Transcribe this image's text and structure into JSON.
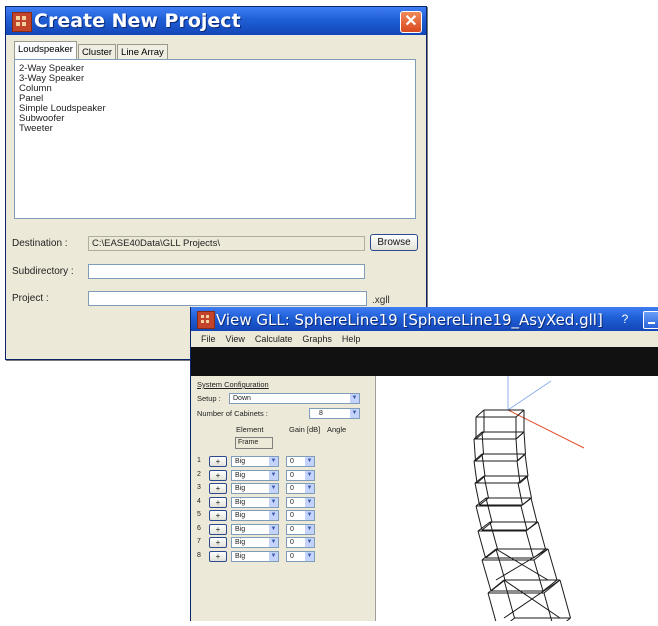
{
  "create_project": {
    "title": "Create New Project",
    "close_glyph": "✕",
    "tabs": [
      "Loudspeaker",
      "Cluster",
      "Line Array"
    ],
    "list_items": [
      "2-Way Speaker",
      "3-Way Speaker",
      "Column",
      "Panel",
      "Simple Loudspeaker",
      "Subwoofer",
      "Tweeter"
    ],
    "destination_label": "Destination :",
    "destination_value": "C:\\EASE40Data\\GLL Projects\\",
    "browse_label": "Browse",
    "subdirectory_label": "Subdirectory :",
    "subdirectory_value": "",
    "project_label": "Project :",
    "project_value": "",
    "project_suffix": ".xgll"
  },
  "view_gll": {
    "title": "View GLL: SphereLine19 [SphereLine19_AsyXed.gll]",
    "help_glyph": "?",
    "menu": [
      "File",
      "View",
      "Calculate",
      "Graphs",
      "Help"
    ],
    "config": {
      "section_title": "System Configuration",
      "setup_label": "Setup :",
      "setup_value": "Down",
      "cabinets_label": "Number of Cabinets :",
      "cabinets_value": "8",
      "col_element": "Element",
      "col_gain": "Gain [dB]",
      "col_angle": "Angle",
      "frame_label": "Frame",
      "plus_glyph": "+",
      "rows": [
        {
          "num": "1",
          "element": "Big",
          "gain": "0"
        },
        {
          "num": "2",
          "element": "Big",
          "gain": "0"
        },
        {
          "num": "3",
          "element": "Big",
          "gain": "0"
        },
        {
          "num": "4",
          "element": "Big",
          "gain": "0"
        },
        {
          "num": "5",
          "element": "Big",
          "gain": "0"
        },
        {
          "num": "6",
          "element": "Big",
          "gain": "0"
        },
        {
          "num": "7",
          "element": "Big",
          "gain": "0"
        },
        {
          "num": "8",
          "element": "Big",
          "gain": "0"
        }
      ]
    }
  },
  "colors": {
    "titlebar": "#1f5fd6",
    "window_bg": "#ece9d8",
    "close_button": "#d9481f",
    "toolbar_strip": "#111111",
    "axis_red": "#e0542e",
    "axis_blue": "#8fb0e8"
  }
}
